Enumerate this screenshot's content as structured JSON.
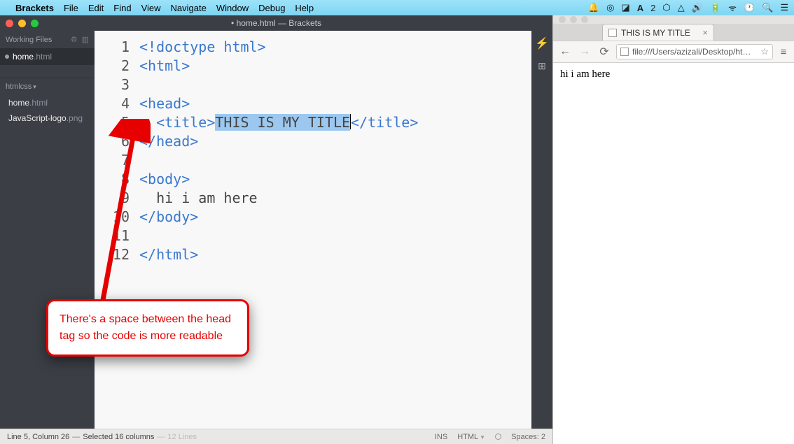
{
  "mac_menu": {
    "app": "Brackets",
    "items": [
      "File",
      "Edit",
      "Find",
      "View",
      "Navigate",
      "Window",
      "Debug",
      "Help"
    ]
  },
  "brackets": {
    "title": "• home.html — Brackets",
    "sidebar": {
      "working_label": "Working Files",
      "working_files": [
        {
          "name": "home",
          "ext": ".html",
          "dirty": true,
          "active": true
        }
      ],
      "project_name": "htmlcss",
      "files": [
        {
          "name": "home",
          "ext": ".html"
        },
        {
          "name": "JavaScript-logo",
          "ext": ".png"
        }
      ]
    },
    "editor": {
      "lines": [
        {
          "n": 1,
          "tokens": [
            {
              "t": "<!doctype html>",
              "cls": "tok-doctype"
            }
          ]
        },
        {
          "n": 2,
          "tokens": [
            {
              "t": "<html>",
              "cls": "tok-tag"
            }
          ]
        },
        {
          "n": 3,
          "tokens": []
        },
        {
          "n": 4,
          "tokens": [
            {
              "t": "<head>",
              "cls": "tok-tag"
            }
          ]
        },
        {
          "n": 5,
          "tokens": [
            {
              "t": "  ",
              "cls": ""
            },
            {
              "t": "<title>",
              "cls": "tok-tag"
            },
            {
              "t": "THIS IS MY TITLE",
              "cls": "tok-txt sel"
            },
            {
              "t": "",
              "cls": "caret"
            },
            {
              "t": "</title>",
              "cls": "tok-tag"
            }
          ]
        },
        {
          "n": 6,
          "tokens": [
            {
              "t": "</head>",
              "cls": "tok-tag"
            }
          ]
        },
        {
          "n": 7,
          "tokens": []
        },
        {
          "n": 8,
          "tokens": [
            {
              "t": "<body>",
              "cls": "tok-tag"
            }
          ]
        },
        {
          "n": 9,
          "tokens": [
            {
              "t": "  hi i am here",
              "cls": "tok-txt"
            }
          ]
        },
        {
          "n": 10,
          "tokens": [
            {
              "t": "</body>",
              "cls": "tok-tag"
            }
          ]
        },
        {
          "n": 11,
          "tokens": []
        },
        {
          "n": 12,
          "tokens": [
            {
              "t": "</html>",
              "cls": "tok-tag"
            }
          ]
        }
      ]
    },
    "status": {
      "cursor": "Line 5, Column 26",
      "selection": "Selected 16 columns",
      "lines": "12 Lines",
      "ins": "INS",
      "lang": "HTML",
      "spaces": "Spaces: 2"
    }
  },
  "annotation": {
    "text": "There's a space between the head tag so the code is more readable"
  },
  "chrome": {
    "tab_title": "THIS IS MY TITLE",
    "url": "file:///Users/azizali/Desktop/htm…",
    "body_text": "hi i am here"
  }
}
